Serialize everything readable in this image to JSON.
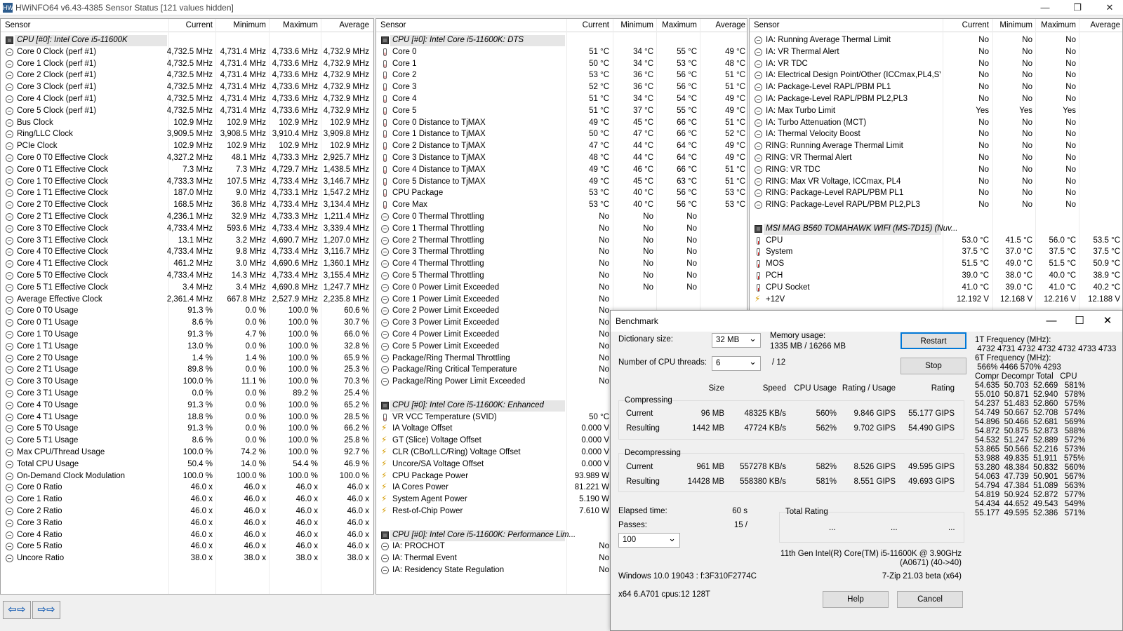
{
  "window": {
    "title": "HWiNFO64 v6.43-4385 Sensor Status [121 values hidden]",
    "app_icon": "HW"
  },
  "columns": [
    "Sensor",
    "Current",
    "Minimum",
    "Maximum",
    "Average"
  ],
  "panel1": [
    {
      "g": "CPU [#0]: Intel Core i5-11600K",
      "i": "ch"
    },
    {
      "n": "Core 0 Clock (perf #1)",
      "i": "cl",
      "v": [
        "4,732.5 MHz",
        "4,731.4 MHz",
        "4,733.6 MHz",
        "4,732.9 MHz"
      ]
    },
    {
      "n": "Core 1 Clock (perf #1)",
      "i": "cl",
      "v": [
        "4,732.5 MHz",
        "4,731.4 MHz",
        "4,733.6 MHz",
        "4,732.9 MHz"
      ]
    },
    {
      "n": "Core 2 Clock (perf #1)",
      "i": "cl",
      "v": [
        "4,732.5 MHz",
        "4,731.4 MHz",
        "4,733.6 MHz",
        "4,732.9 MHz"
      ]
    },
    {
      "n": "Core 3 Clock (perf #1)",
      "i": "cl",
      "v": [
        "4,732.5 MHz",
        "4,731.4 MHz",
        "4,733.6 MHz",
        "4,732.9 MHz"
      ]
    },
    {
      "n": "Core 4 Clock (perf #1)",
      "i": "cl",
      "v": [
        "4,732.5 MHz",
        "4,731.4 MHz",
        "4,733.6 MHz",
        "4,732.9 MHz"
      ]
    },
    {
      "n": "Core 5 Clock (perf #1)",
      "i": "cl",
      "v": [
        "4,732.5 MHz",
        "4,731.4 MHz",
        "4,733.6 MHz",
        "4,732.9 MHz"
      ]
    },
    {
      "n": "Bus Clock",
      "i": "cl",
      "v": [
        "102.9 MHz",
        "102.9 MHz",
        "102.9 MHz",
        "102.9 MHz"
      ]
    },
    {
      "n": "Ring/LLC Clock",
      "i": "cl",
      "v": [
        "3,909.5 MHz",
        "3,908.5 MHz",
        "3,910.4 MHz",
        "3,909.8 MHz"
      ]
    },
    {
      "n": "PCIe Clock",
      "i": "cl",
      "v": [
        "102.9 MHz",
        "102.9 MHz",
        "102.9 MHz",
        "102.9 MHz"
      ]
    },
    {
      "n": "Core 0 T0 Effective Clock",
      "i": "cl",
      "v": [
        "4,327.2 MHz",
        "48.1 MHz",
        "4,733.3 MHz",
        "2,925.7 MHz"
      ]
    },
    {
      "n": "Core 0 T1 Effective Clock",
      "i": "cl",
      "v": [
        "7.3 MHz",
        "7.3 MHz",
        "4,729.7 MHz",
        "1,438.5 MHz"
      ]
    },
    {
      "n": "Core 1 T0 Effective Clock",
      "i": "cl",
      "v": [
        "4,733.3 MHz",
        "107.5 MHz",
        "4,733.4 MHz",
        "3,146.7 MHz"
      ]
    },
    {
      "n": "Core 1 T1 Effective Clock",
      "i": "cl",
      "v": [
        "187.0 MHz",
        "9.0 MHz",
        "4,733.1 MHz",
        "1,547.2 MHz"
      ]
    },
    {
      "n": "Core 2 T0 Effective Clock",
      "i": "cl",
      "v": [
        "168.5 MHz",
        "36.8 MHz",
        "4,733.4 MHz",
        "3,134.4 MHz"
      ]
    },
    {
      "n": "Core 2 T1 Effective Clock",
      "i": "cl",
      "v": [
        "4,236.1 MHz",
        "32.9 MHz",
        "4,733.3 MHz",
        "1,211.4 MHz"
      ]
    },
    {
      "n": "Core 3 T0 Effective Clock",
      "i": "cl",
      "v": [
        "4,733.4 MHz",
        "593.6 MHz",
        "4,733.4 MHz",
        "3,339.4 MHz"
      ]
    },
    {
      "n": "Core 3 T1 Effective Clock",
      "i": "cl",
      "v": [
        "13.1 MHz",
        "3.2 MHz",
        "4,690.7 MHz",
        "1,207.0 MHz"
      ]
    },
    {
      "n": "Core 4 T0 Effective Clock",
      "i": "cl",
      "v": [
        "4,733.4 MHz",
        "9.8 MHz",
        "4,733.4 MHz",
        "3,116.7 MHz"
      ]
    },
    {
      "n": "Core 4 T1 Effective Clock",
      "i": "cl",
      "v": [
        "461.2 MHz",
        "3.0 MHz",
        "4,690.6 MHz",
        "1,360.1 MHz"
      ]
    },
    {
      "n": "Core 5 T0 Effective Clock",
      "i": "cl",
      "v": [
        "4,733.4 MHz",
        "14.3 MHz",
        "4,733.4 MHz",
        "3,155.4 MHz"
      ]
    },
    {
      "n": "Core 5 T1 Effective Clock",
      "i": "cl",
      "v": [
        "3.4 MHz",
        "3.4 MHz",
        "4,690.8 MHz",
        "1,247.7 MHz"
      ]
    },
    {
      "n": "Average Effective Clock",
      "i": "cl",
      "v": [
        "2,361.4 MHz",
        "667.8 MHz",
        "2,527.9 MHz",
        "2,235.8 MHz"
      ]
    },
    {
      "n": "Core 0 T0 Usage",
      "i": "cl",
      "v": [
        "91.3 %",
        "0.0 %",
        "100.0 %",
        "60.6 %"
      ]
    },
    {
      "n": "Core 0 T1 Usage",
      "i": "cl",
      "v": [
        "8.6 %",
        "0.0 %",
        "100.0 %",
        "30.7 %"
      ]
    },
    {
      "n": "Core 1 T0 Usage",
      "i": "cl",
      "v": [
        "91.3 %",
        "4.7 %",
        "100.0 %",
        "66.0 %"
      ]
    },
    {
      "n": "Core 1 T1 Usage",
      "i": "cl",
      "v": [
        "13.0 %",
        "0.0 %",
        "100.0 %",
        "32.8 %"
      ]
    },
    {
      "n": "Core 2 T0 Usage",
      "i": "cl",
      "v": [
        "1.4 %",
        "1.4 %",
        "100.0 %",
        "65.9 %"
      ]
    },
    {
      "n": "Core 2 T1 Usage",
      "i": "cl",
      "v": [
        "89.8 %",
        "0.0 %",
        "100.0 %",
        "25.3 %"
      ]
    },
    {
      "n": "Core 3 T0 Usage",
      "i": "cl",
      "v": [
        "100.0 %",
        "11.1 %",
        "100.0 %",
        "70.3 %"
      ]
    },
    {
      "n": "Core 3 T1 Usage",
      "i": "cl",
      "v": [
        "0.0 %",
        "0.0 %",
        "89.2 %",
        "25.4 %"
      ]
    },
    {
      "n": "Core 4 T0 Usage",
      "i": "cl",
      "v": [
        "91.3 %",
        "0.0 %",
        "100.0 %",
        "65.2 %"
      ]
    },
    {
      "n": "Core 4 T1 Usage",
      "i": "cl",
      "v": [
        "18.8 %",
        "0.0 %",
        "100.0 %",
        "28.5 %"
      ]
    },
    {
      "n": "Core 5 T0 Usage",
      "i": "cl",
      "v": [
        "91.3 %",
        "0.0 %",
        "100.0 %",
        "66.2 %"
      ]
    },
    {
      "n": "Core 5 T1 Usage",
      "i": "cl",
      "v": [
        "8.6 %",
        "0.0 %",
        "100.0 %",
        "25.8 %"
      ]
    },
    {
      "n": "Max CPU/Thread Usage",
      "i": "cl",
      "v": [
        "100.0 %",
        "74.2 %",
        "100.0 %",
        "92.7 %"
      ]
    },
    {
      "n": "Total CPU Usage",
      "i": "cl",
      "v": [
        "50.4 %",
        "14.0 %",
        "54.4 %",
        "46.9 %"
      ]
    },
    {
      "n": "On-Demand Clock Modulation",
      "i": "cl",
      "v": [
        "100.0 %",
        "100.0 %",
        "100.0 %",
        "100.0 %"
      ]
    },
    {
      "n": "Core 0 Ratio",
      "i": "cl",
      "v": [
        "46.0 x",
        "46.0 x",
        "46.0 x",
        "46.0 x"
      ]
    },
    {
      "n": "Core 1 Ratio",
      "i": "cl",
      "v": [
        "46.0 x",
        "46.0 x",
        "46.0 x",
        "46.0 x"
      ]
    },
    {
      "n": "Core 2 Ratio",
      "i": "cl",
      "v": [
        "46.0 x",
        "46.0 x",
        "46.0 x",
        "46.0 x"
      ]
    },
    {
      "n": "Core 3 Ratio",
      "i": "cl",
      "v": [
        "46.0 x",
        "46.0 x",
        "46.0 x",
        "46.0 x"
      ]
    },
    {
      "n": "Core 4 Ratio",
      "i": "cl",
      "v": [
        "46.0 x",
        "46.0 x",
        "46.0 x",
        "46.0 x"
      ]
    },
    {
      "n": "Core 5 Ratio",
      "i": "cl",
      "v": [
        "46.0 x",
        "46.0 x",
        "46.0 x",
        "46.0 x"
      ]
    },
    {
      "n": "Uncore Ratio",
      "i": "cl",
      "v": [
        "38.0 x",
        "38.0 x",
        "38.0 x",
        "38.0 x"
      ]
    }
  ],
  "panel2": [
    {
      "g": "CPU [#0]: Intel Core i5-11600K: DTS",
      "i": "ch"
    },
    {
      "n": "Core 0",
      "i": "th",
      "v": [
        "51 °C",
        "34 °C",
        "55 °C",
        "49 °C"
      ]
    },
    {
      "n": "Core 1",
      "i": "th",
      "v": [
        "50 °C",
        "34 °C",
        "53 °C",
        "48 °C"
      ]
    },
    {
      "n": "Core 2",
      "i": "th",
      "v": [
        "53 °C",
        "36 °C",
        "56 °C",
        "51 °C"
      ]
    },
    {
      "n": "Core 3",
      "i": "th",
      "v": [
        "52 °C",
        "36 °C",
        "56 °C",
        "51 °C"
      ]
    },
    {
      "n": "Core 4",
      "i": "th",
      "v": [
        "51 °C",
        "34 °C",
        "54 °C",
        "49 °C"
      ]
    },
    {
      "n": "Core 5",
      "i": "th",
      "v": [
        "51 °C",
        "37 °C",
        "55 °C",
        "49 °C"
      ]
    },
    {
      "n": "Core 0 Distance to TjMAX",
      "i": "th",
      "v": [
        "49 °C",
        "45 °C",
        "66 °C",
        "51 °C"
      ]
    },
    {
      "n": "Core 1 Distance to TjMAX",
      "i": "th",
      "v": [
        "50 °C",
        "47 °C",
        "66 °C",
        "52 °C"
      ]
    },
    {
      "n": "Core 2 Distance to TjMAX",
      "i": "th",
      "v": [
        "47 °C",
        "44 °C",
        "64 °C",
        "49 °C"
      ]
    },
    {
      "n": "Core 3 Distance to TjMAX",
      "i": "th",
      "v": [
        "48 °C",
        "44 °C",
        "64 °C",
        "49 °C"
      ]
    },
    {
      "n": "Core 4 Distance to TjMAX",
      "i": "th",
      "v": [
        "49 °C",
        "46 °C",
        "66 °C",
        "51 °C"
      ]
    },
    {
      "n": "Core 5 Distance to TjMAX",
      "i": "th",
      "v": [
        "49 °C",
        "45 °C",
        "63 °C",
        "51 °C"
      ]
    },
    {
      "n": "CPU Package",
      "i": "th",
      "v": [
        "53 °C",
        "40 °C",
        "56 °C",
        "53 °C"
      ]
    },
    {
      "n": "Core Max",
      "i": "th",
      "v": [
        "53 °C",
        "40 °C",
        "56 °C",
        "53 °C"
      ]
    },
    {
      "n": "Core 0 Thermal Throttling",
      "i": "cl",
      "v": [
        "No",
        "No",
        "No",
        ""
      ]
    },
    {
      "n": "Core 1 Thermal Throttling",
      "i": "cl",
      "v": [
        "No",
        "No",
        "No",
        ""
      ]
    },
    {
      "n": "Core 2 Thermal Throttling",
      "i": "cl",
      "v": [
        "No",
        "No",
        "No",
        ""
      ]
    },
    {
      "n": "Core 3 Thermal Throttling",
      "i": "cl",
      "v": [
        "No",
        "No",
        "No",
        ""
      ]
    },
    {
      "n": "Core 4 Thermal Throttling",
      "i": "cl",
      "v": [
        "No",
        "No",
        "No",
        ""
      ]
    },
    {
      "n": "Core 5 Thermal Throttling",
      "i": "cl",
      "v": [
        "No",
        "No",
        "No",
        ""
      ]
    },
    {
      "n": "Core 0 Power Limit Exceeded",
      "i": "cl",
      "v": [
        "No",
        "No",
        "No",
        ""
      ]
    },
    {
      "n": "Core 1 Power Limit Exceeded",
      "i": "cl",
      "v": [
        "No",
        "",
        "",
        ""
      ]
    },
    {
      "n": "Core 2 Power Limit Exceeded",
      "i": "cl",
      "v": [
        "No",
        "",
        "",
        ""
      ]
    },
    {
      "n": "Core 3 Power Limit Exceeded",
      "i": "cl",
      "v": [
        "No",
        "",
        "",
        ""
      ]
    },
    {
      "n": "Core 4 Power Limit Exceeded",
      "i": "cl",
      "v": [
        "No",
        "",
        "",
        ""
      ]
    },
    {
      "n": "Core 5 Power Limit Exceeded",
      "i": "cl",
      "v": [
        "No",
        "",
        "",
        ""
      ]
    },
    {
      "n": "Package/Ring Thermal Throttling",
      "i": "cl",
      "v": [
        "No",
        "",
        "",
        ""
      ]
    },
    {
      "n": "Package/Ring Critical Temperature",
      "i": "cl",
      "v": [
        "No",
        "",
        "",
        ""
      ]
    },
    {
      "n": "Package/Ring Power Limit Exceeded",
      "i": "cl",
      "v": [
        "No",
        "",
        "",
        ""
      ]
    },
    {
      "blank": true
    },
    {
      "g": "CPU [#0]: Intel Core i5-11600K: Enhanced",
      "i": "ch"
    },
    {
      "n": "VR VCC Temperature (SVID)",
      "i": "th",
      "v": [
        "50 °C",
        "",
        "",
        ""
      ]
    },
    {
      "n": "IA Voltage Offset",
      "i": "vo",
      "v": [
        "0.000 V",
        "",
        "",
        ""
      ]
    },
    {
      "n": "GT (Slice) Voltage Offset",
      "i": "vo",
      "v": [
        "0.000 V",
        "",
        "",
        ""
      ]
    },
    {
      "n": "CLR (CBo/LLC/Ring) Voltage Offset",
      "i": "vo",
      "v": [
        "0.000 V",
        "",
        "",
        ""
      ]
    },
    {
      "n": "Uncore/SA Voltage Offset",
      "i": "vo",
      "v": [
        "0.000 V",
        "",
        "",
        ""
      ]
    },
    {
      "n": "CPU Package Power",
      "i": "vo",
      "v": [
        "93.989 W",
        "",
        "",
        ""
      ]
    },
    {
      "n": "IA Cores Power",
      "i": "vo",
      "v": [
        "81.221 W",
        "",
        "",
        ""
      ]
    },
    {
      "n": "System Agent Power",
      "i": "vo",
      "v": [
        "5.190 W",
        "",
        "",
        ""
      ]
    },
    {
      "n": "Rest-of-Chip Power",
      "i": "vo",
      "v": [
        "7.610 W",
        "",
        "",
        ""
      ]
    },
    {
      "blank": true
    },
    {
      "g": "CPU [#0]: Intel Core i5-11600K: Performance Lim...",
      "i": "ch"
    },
    {
      "n": "IA: PROCHOT",
      "i": "cl",
      "v": [
        "No",
        "",
        "",
        ""
      ]
    },
    {
      "n": "IA: Thermal Event",
      "i": "cl",
      "v": [
        "No",
        "",
        "",
        ""
      ]
    },
    {
      "n": "IA: Residency State Regulation",
      "i": "cl",
      "v": [
        "No",
        "",
        "",
        ""
      ]
    }
  ],
  "panel3": [
    {
      "n": "IA: Running Average Thermal Limit",
      "i": "cl",
      "v": [
        "No",
        "No",
        "No",
        ""
      ]
    },
    {
      "n": "IA: VR Thermal Alert",
      "i": "cl",
      "v": [
        "No",
        "No",
        "No",
        ""
      ]
    },
    {
      "n": "IA: VR TDC",
      "i": "cl",
      "v": [
        "No",
        "No",
        "No",
        ""
      ]
    },
    {
      "n": "IA: Electrical Design Point/Other (ICCmax,PL4,SV...",
      "i": "cl",
      "v": [
        "No",
        "No",
        "No",
        ""
      ]
    },
    {
      "n": "IA: Package-Level RAPL/PBM PL1",
      "i": "cl",
      "v": [
        "No",
        "No",
        "No",
        ""
      ]
    },
    {
      "n": "IA: Package-Level RAPL/PBM PL2,PL3",
      "i": "cl",
      "v": [
        "No",
        "No",
        "No",
        ""
      ]
    },
    {
      "n": "IA: Max Turbo Limit",
      "i": "cl",
      "v": [
        "Yes",
        "Yes",
        "Yes",
        ""
      ]
    },
    {
      "n": "IA: Turbo Attenuation (MCT)",
      "i": "cl",
      "v": [
        "No",
        "No",
        "No",
        ""
      ]
    },
    {
      "n": "IA: Thermal Velocity Boost",
      "i": "cl",
      "v": [
        "No",
        "No",
        "No",
        ""
      ]
    },
    {
      "n": "RING: Running Average Thermal Limit",
      "i": "cl",
      "v": [
        "No",
        "No",
        "No",
        ""
      ]
    },
    {
      "n": "RING: VR Thermal Alert",
      "i": "cl",
      "v": [
        "No",
        "No",
        "No",
        ""
      ]
    },
    {
      "n": "RING: VR TDC",
      "i": "cl",
      "v": [
        "No",
        "No",
        "No",
        ""
      ]
    },
    {
      "n": "RING: Max VR Voltage, ICCmax, PL4",
      "i": "cl",
      "v": [
        "No",
        "No",
        "No",
        ""
      ]
    },
    {
      "n": "RING: Package-Level RAPL/PBM PL1",
      "i": "cl",
      "v": [
        "No",
        "No",
        "No",
        ""
      ]
    },
    {
      "n": "RING: Package-Level RAPL/PBM PL2,PL3",
      "i": "cl",
      "v": [
        "No",
        "No",
        "No",
        ""
      ]
    },
    {
      "blank": true
    },
    {
      "g": "MSI MAG B560 TOMAHAWK WIFI (MS-7D15) (Nuv...",
      "i": "ch"
    },
    {
      "n": "CPU",
      "i": "th",
      "v": [
        "53.0 °C",
        "41.5 °C",
        "56.0 °C",
        "53.5 °C"
      ]
    },
    {
      "n": "System",
      "i": "th",
      "v": [
        "37.5 °C",
        "37.0 °C",
        "37.5 °C",
        "37.5 °C"
      ]
    },
    {
      "n": "MOS",
      "i": "th",
      "v": [
        "51.5 °C",
        "49.0 °C",
        "51.5 °C",
        "50.9 °C"
      ]
    },
    {
      "n": "PCH",
      "i": "th",
      "v": [
        "39.0 °C",
        "38.0 °C",
        "40.0 °C",
        "38.9 °C"
      ]
    },
    {
      "n": "CPU Socket",
      "i": "th",
      "v": [
        "41.0 °C",
        "39.0 °C",
        "41.0 °C",
        "40.2 °C"
      ]
    },
    {
      "n": "+12V",
      "i": "vo",
      "v": [
        "12.192 V",
        "12.168 V",
        "12.216 V",
        "12.188 V"
      ]
    }
  ],
  "nav": {
    "left": "⇦⇨",
    "right": "⇨⇨"
  },
  "bench": {
    "title": "Benchmark",
    "dict_label": "Dictionary size:",
    "dict_value": "32 MB",
    "threads_label": "Number of CPU threads:",
    "threads_value": "6",
    "threads_total": "/ 12",
    "mem_label": "Memory usage:",
    "mem_value": "1335 MB / 16266 MB",
    "restart": "Restart",
    "stop": "Stop",
    "help": "Help",
    "cancel": "Cancel",
    "headers": [
      "Size",
      "Speed",
      "CPU Usage",
      "Rating / Usage",
      "Rating"
    ],
    "compressing": "Compressing",
    "decompressing": "Decompressing",
    "comp_rows": [
      [
        "Current",
        "96 MB",
        "48325 KB/s",
        "560%",
        "9.846 GIPS",
        "55.177 GIPS"
      ],
      [
        "Resulting",
        "1442 MB",
        "47724 KB/s",
        "562%",
        "9.702 GIPS",
        "54.490 GIPS"
      ]
    ],
    "decomp_rows": [
      [
        "Current",
        "961 MB",
        "557278 KB/s",
        "582%",
        "8.526 GIPS",
        "49.595 GIPS"
      ],
      [
        "Resulting",
        "14428 MB",
        "558380 KB/s",
        "581%",
        "8.551 GIPS",
        "49.693 GIPS"
      ]
    ],
    "elapsed_label": "Elapsed time:",
    "elapsed_value": "60 s",
    "passes_label": "Passes:",
    "passes_value": "15 /",
    "passes_select": "100",
    "total_rating": "Total Rating",
    "dots": [
      "...",
      "...",
      "..."
    ],
    "cpu_name": "11th Gen Intel(R) Core(TM) i5-11600K @ 3.90GHz",
    "cpu_id": "(A0671) (40->40)",
    "os": "Windows 10.0 19043 : f:3F310F2774C",
    "zip": "7-Zip 21.03 beta (x64)",
    "arch": "x64 6.A701 cpus:12 128T",
    "right_info": "1T Frequency (MHz):\n 4732 4731 4732 4732 4732 4733 4733\n6T Frequency (MHz):\n 566% 4466 570% 4293\nCompr Decompr Total   CPU\n54.635  50.703  52.669   581%\n55.010  50.871  52.940   578%\n54.237  51.483  52.860   575%\n54.749  50.667  52.708   574%\n54.896  50.466  52.681   569%\n54.872  50.875  52.873   588%\n54.532  51.247  52.889   572%\n53.865  50.566  52.216   573%\n53.988  49.835  51.911   575%\n53.280  48.384  50.832   560%\n54.063  47.739  50.901   567%\n54.794  47.384  51.089   563%\n54.819  50.924  52.872   577%\n54.434  44.652  49.543   549%\n55.177  49.595  52.386   571%"
  }
}
